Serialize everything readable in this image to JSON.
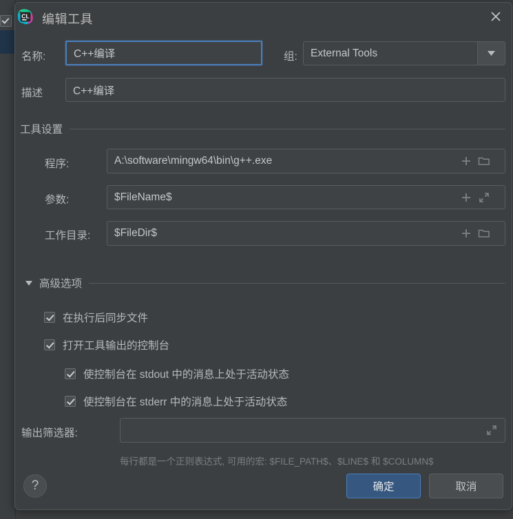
{
  "window": {
    "title": "编辑工具",
    "app_icon": "clion-logo-icon",
    "close_icon": "close-icon"
  },
  "form": {
    "name_label": "名称:",
    "name_value": "C++编译",
    "group_label": "组:",
    "group_value": "External Tools",
    "description_label": "描述",
    "description_value": "C++编译"
  },
  "tool_settings": {
    "section_title": "工具设置",
    "program_label": "程序:",
    "program_value": "A:\\software\\mingw64\\bin\\g++.exe",
    "arguments_label": "参数:",
    "arguments_value": "$FileName$",
    "workdir_label": "工作目录:",
    "workdir_value": "$FileDir$"
  },
  "advanced": {
    "section_title": "高级选项",
    "expanded": true,
    "options": [
      {
        "label": "在执行后同步文件",
        "checked": true
      },
      {
        "label": "打开工具输出的控制台",
        "checked": true
      },
      {
        "label": "使控制台在 stdout 中的消息上处于活动状态",
        "checked": true
      },
      {
        "label": "使控制台在 stderr 中的消息上处于活动状态",
        "checked": true
      }
    ],
    "output_filter_label": "输出筛选器:",
    "output_filter_value": "",
    "hint": "每行都是一个正则表达式, 可用的宏: $FILE_PATH$、$LINE$ 和 $COLUMN$"
  },
  "footer": {
    "help_label": "?",
    "ok_label": "确定",
    "cancel_label": "取消"
  },
  "colors": {
    "dialog_bg": "#3c3f41",
    "field_bg": "#45484a",
    "accent_focus": "#4a7ebb",
    "ok_button_bg": "#365880",
    "text": "#b6b9bb",
    "hint_text": "#7b7f82"
  }
}
